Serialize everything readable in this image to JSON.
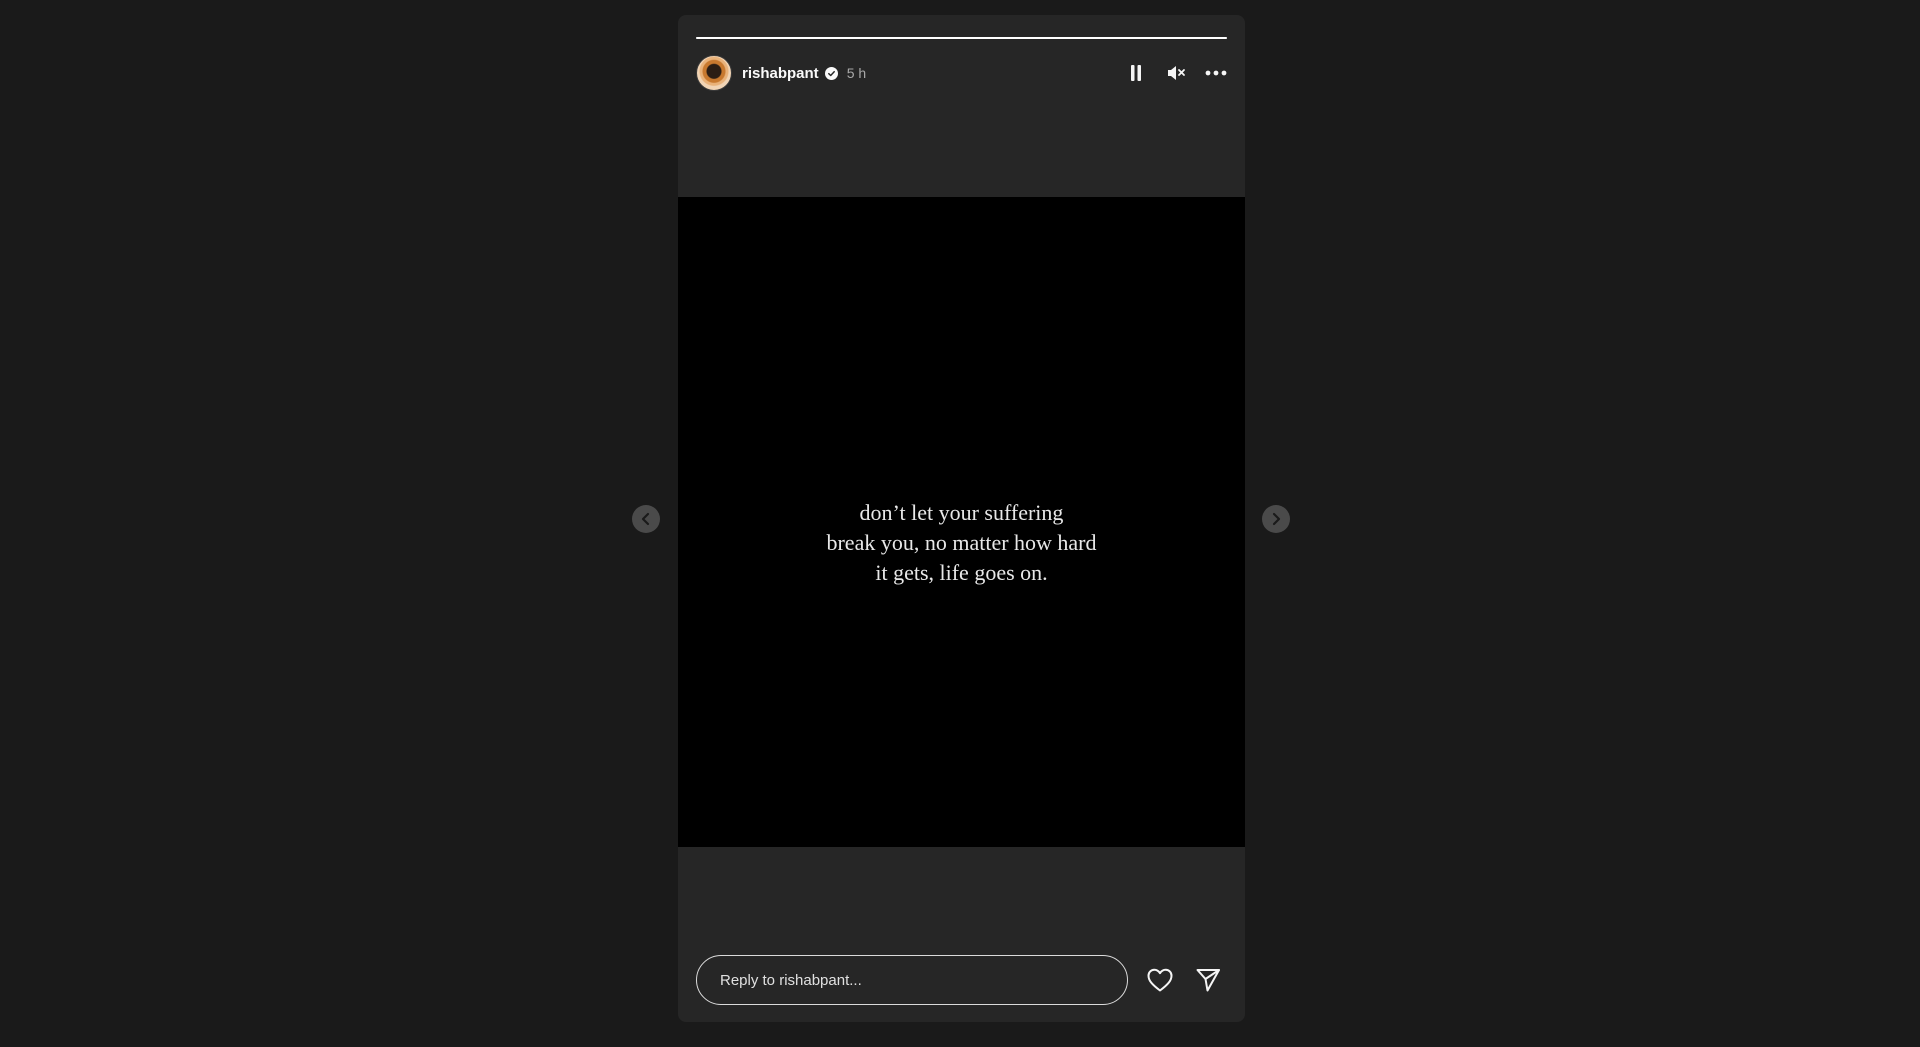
{
  "story": {
    "progress": 1.0,
    "user": {
      "username": "rishabpant",
      "verified": true,
      "time": "5 h"
    },
    "controls": {
      "pause_icon": "pause-icon",
      "mute_icon": "muted-speaker-icon",
      "more_icon": "more-options-icon"
    },
    "content": {
      "lines": [
        "don’t let your suffering",
        "break you, no matter how hard",
        "it gets, life goes on."
      ]
    },
    "reply": {
      "placeholder": "Reply to rishabpant..."
    },
    "actions": {
      "like_icon": "heart-icon",
      "share_icon": "send-icon"
    }
  },
  "navigation": {
    "prev_icon": "chevron-left-icon",
    "next_icon": "chevron-right-icon"
  },
  "colors": {
    "page_background": "#1a1a1a",
    "story_background": "#262626",
    "media_background": "#000000",
    "text": "#f5f5f5",
    "muted_text": "#a8a8a8"
  }
}
